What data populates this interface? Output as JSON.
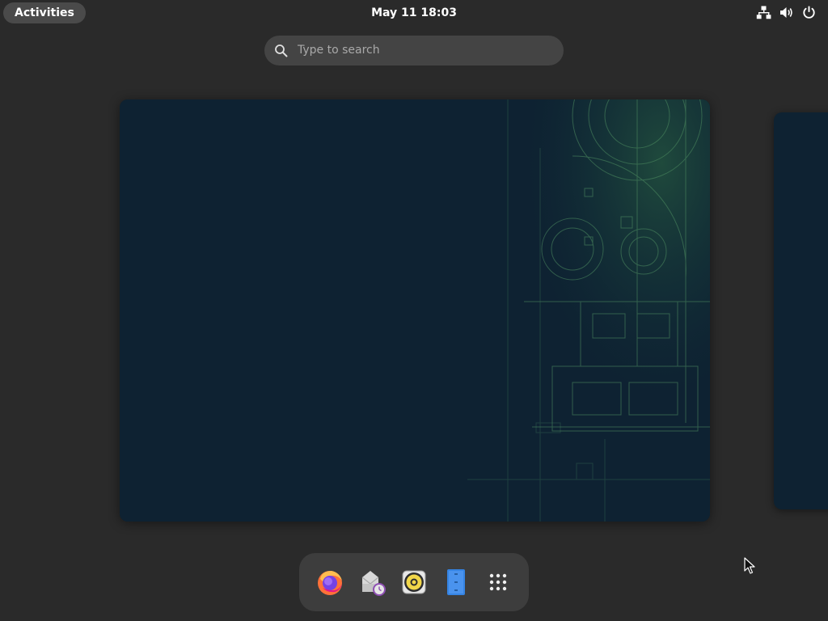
{
  "topbar": {
    "activities_label": "Activities",
    "clock": "May 11  18:03",
    "tray_icons": [
      "network-icon",
      "volume-icon",
      "power-icon"
    ]
  },
  "search": {
    "placeholder": "Type to search"
  },
  "workspaces": {
    "current": "workspace-1",
    "wallpaper_colors": {
      "base": "#0e2232",
      "accent": "#3c8a4a"
    }
  },
  "dash": {
    "items": [
      {
        "name": "Firefox",
        "icon": "firefox-icon"
      },
      {
        "name": "Evolution",
        "icon": "evolution-mail-icon"
      },
      {
        "name": "Rhythmbox",
        "icon": "rhythmbox-icon"
      },
      {
        "name": "Text Editor",
        "icon": "text-editor-icon"
      },
      {
        "name": "Show Applications",
        "icon": "app-grid-icon"
      }
    ]
  },
  "colors": {
    "background": "#2a2a2a",
    "pill": "#4a4a4a",
    "search_bg": "#444444",
    "dash_bg": "#3d3d3d",
    "placeholder_text": "#a9a9a9"
  }
}
